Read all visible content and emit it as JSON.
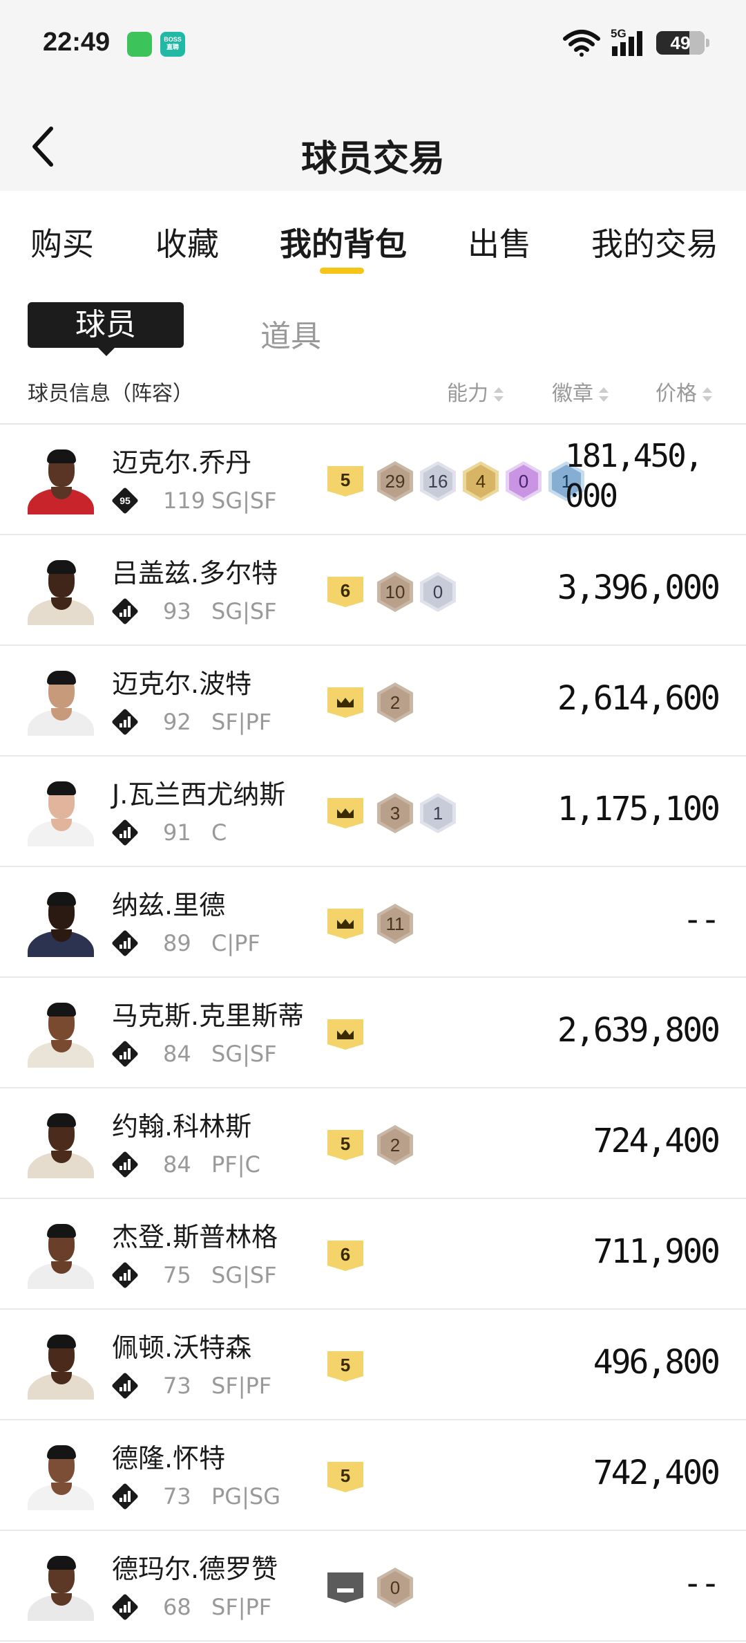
{
  "status": {
    "time": "22:49",
    "boss_label_1": "BOSS",
    "boss_label_2": "直聘",
    "network": "5G",
    "battery": "49"
  },
  "header": {
    "title": "球员交易"
  },
  "tabs": [
    "购买",
    "收藏",
    "我的背包",
    "出售",
    "我的交易"
  ],
  "active_tab": "我的背包",
  "subtabs": {
    "active": "球员",
    "other": "道具"
  },
  "columns": {
    "info": "球员信息（阵容）",
    "ability": "能力",
    "badge": "徽章",
    "price": "价格"
  },
  "colors": {
    "accent": "#f5c518",
    "tier": "#f3d36a"
  },
  "players": [
    {
      "name": "迈克尔.乔丹",
      "ovr": "119",
      "pos": "SG|SF",
      "icon": "95",
      "tier": "5",
      "badges": [
        {
          "c": "bronze",
          "v": "29"
        },
        {
          "c": "silver",
          "v": "16"
        },
        {
          "c": "gold",
          "v": "4"
        },
        {
          "c": "purple",
          "v": "0"
        },
        {
          "c": "blue",
          "v": "1"
        }
      ],
      "price": "181,450,000"
    },
    {
      "name": "吕盖兹.多尔特",
      "ovr": "93",
      "pos": "SG|SF",
      "icon": "",
      "tier": "6",
      "badges": [
        {
          "c": "bronze",
          "v": "10"
        },
        {
          "c": "silver",
          "v": "0"
        }
      ],
      "price": "3,396,000"
    },
    {
      "name": "迈克尔.波特",
      "ovr": "92",
      "pos": "SF|PF",
      "icon": "",
      "tier": "crown",
      "badges": [
        {
          "c": "bronze",
          "v": "2"
        }
      ],
      "price": "2,614,600"
    },
    {
      "name": "J.瓦兰西尤纳斯",
      "ovr": "91",
      "pos": "C",
      "icon": "",
      "tier": "crown",
      "badges": [
        {
          "c": "bronze",
          "v": "3"
        },
        {
          "c": "silver",
          "v": "1"
        }
      ],
      "price": "1,175,100"
    },
    {
      "name": "纳兹.里德",
      "ovr": "89",
      "pos": "C|PF",
      "icon": "",
      "tier": "crown",
      "badges": [
        {
          "c": "bronze",
          "v": "11"
        }
      ],
      "price": "--"
    },
    {
      "name": "马克斯.克里斯蒂",
      "ovr": "84",
      "pos": "SG|SF",
      "icon": "",
      "tier": "crown",
      "badges": [],
      "price": "2,639,800"
    },
    {
      "name": "约翰.科林斯",
      "ovr": "84",
      "pos": "PF|C",
      "icon": "",
      "tier": "5",
      "badges": [
        {
          "c": "bronze",
          "v": "2"
        }
      ],
      "price": "724,400"
    },
    {
      "name": "杰登.斯普林格",
      "ovr": "75",
      "pos": "SG|SF",
      "icon": "",
      "tier": "6",
      "badges": [],
      "price": "711,900"
    },
    {
      "name": "佩顿.沃特森",
      "ovr": "73",
      "pos": "SF|PF",
      "icon": "",
      "tier": "5",
      "badges": [],
      "price": "496,800"
    },
    {
      "name": "德隆.怀特",
      "ovr": "73",
      "pos": "PG|SG",
      "icon": "",
      "tier": "5",
      "badges": [],
      "price": "742,400"
    },
    {
      "name": "德玛尔.德罗赞",
      "ovr": "68",
      "pos": "SF|PF",
      "icon": "",
      "tier": "dash",
      "badges": [
        {
          "c": "bronze",
          "v": "0"
        }
      ],
      "price": "--"
    }
  ]
}
